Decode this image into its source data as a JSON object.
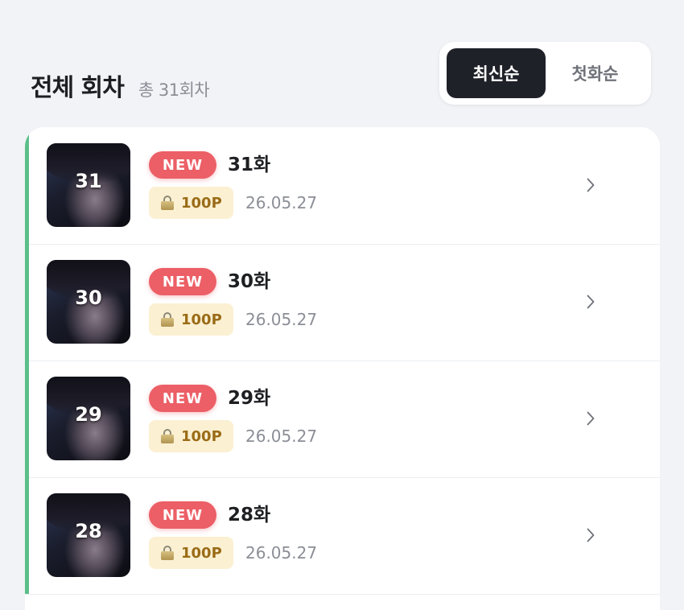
{
  "header": {
    "title": "전체 회차",
    "count": "총 31회차"
  },
  "sort": {
    "latest": "최신순",
    "first": "첫화순",
    "selected": "최신순"
  },
  "episodes": [
    {
      "thumb_number": "31",
      "badge": "NEW",
      "title": "31화",
      "price": "100P",
      "date": "26.05.27"
    },
    {
      "thumb_number": "30",
      "badge": "NEW",
      "title": "30화",
      "price": "100P",
      "date": "26.05.27"
    },
    {
      "thumb_number": "29",
      "badge": "NEW",
      "title": "29화",
      "price": "100P",
      "date": "26.05.27"
    },
    {
      "thumb_number": "28",
      "badge": "NEW",
      "title": "28화",
      "price": "100P",
      "date": "26.05.27"
    }
  ],
  "icons": {
    "lock": "lock-icon",
    "chevron": "chevron-right-icon"
  },
  "colors": {
    "accent_bar": "#5cbf8a",
    "new_badge": "#ec5f66",
    "price_bg": "#fbf0d2",
    "price_text": "#9a6b17",
    "active_sort_bg": "#1f2128"
  }
}
